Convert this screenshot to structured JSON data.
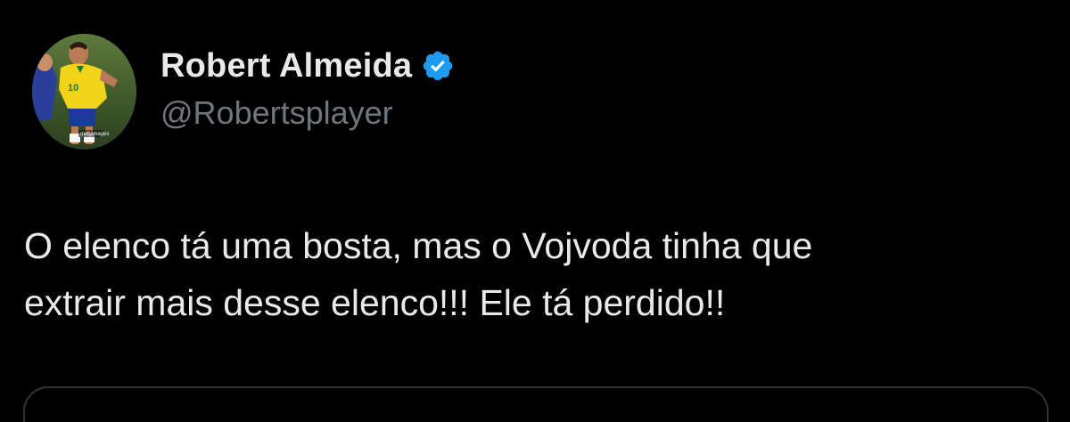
{
  "author": {
    "display_name": "Robert Almeida",
    "handle": "@Robertsplayer",
    "verified_icon": "verified-badge-icon",
    "avatar_watermark": "gettyimages"
  },
  "tweet": {
    "text_lines": [
      "O elenco tá uma bosta, mas o Vojvoda tinha que",
      "extrair mais desse elenco!!! Ele tá perdido!!"
    ]
  },
  "colors": {
    "background": "#000000",
    "text": "#e7e9ea",
    "secondary_text": "#71767b",
    "verified_blue": "#1d9bf0",
    "border": "#2f3336"
  }
}
